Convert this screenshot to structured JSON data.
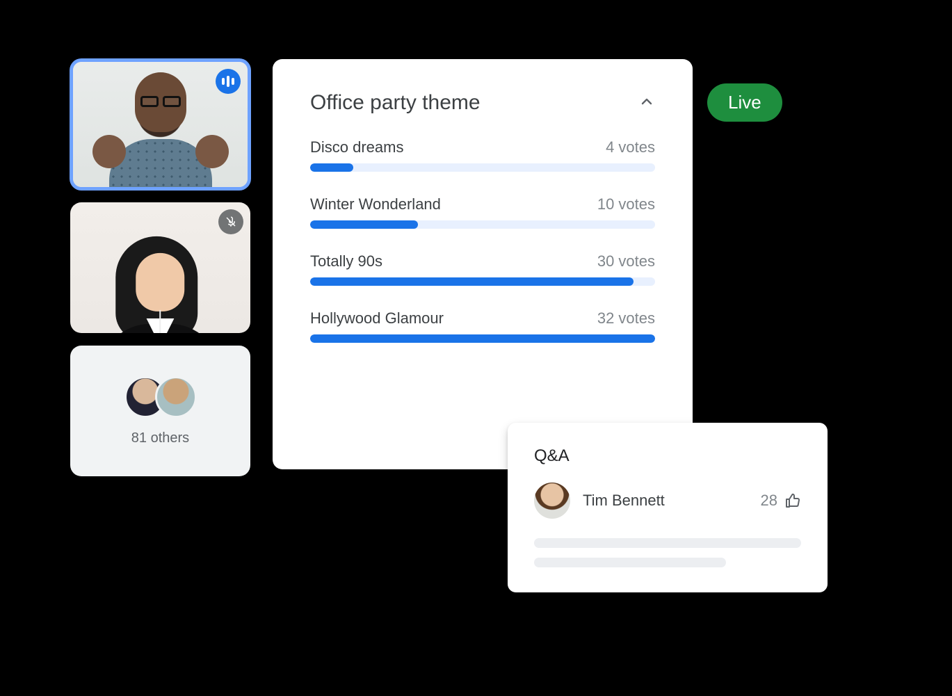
{
  "participants": {
    "others_count": 81,
    "others_label": "81 others",
    "tiles": [
      {
        "status": "speaking"
      },
      {
        "status": "muted"
      }
    ]
  },
  "live_label": "Live",
  "poll": {
    "title": "Office party theme",
    "max_votes": 32,
    "options": [
      {
        "label": "Disco dreams",
        "votes": 4,
        "votes_label": "4 votes"
      },
      {
        "label": "Winter Wonderland",
        "votes": 10,
        "votes_label": "10 votes"
      },
      {
        "label": "Totally 90s",
        "votes": 30,
        "votes_label": "30 votes"
      },
      {
        "label": "Hollywood Glamour",
        "votes": 32,
        "votes_label": "32 votes"
      }
    ]
  },
  "qa": {
    "title": "Q&A",
    "entry": {
      "name": "Tim Bennett",
      "upvotes": 28
    }
  },
  "colors": {
    "accent": "#1a73e8",
    "live": "#1e8e3e"
  },
  "chart_data": {
    "type": "bar",
    "title": "Office party theme",
    "categories": [
      "Disco dreams",
      "Winter Wonderland",
      "Totally 90s",
      "Hollywood Glamour"
    ],
    "values": [
      4,
      10,
      30,
      32
    ],
    "xlabel": "",
    "ylabel": "votes",
    "ylim": [
      0,
      32
    ]
  }
}
